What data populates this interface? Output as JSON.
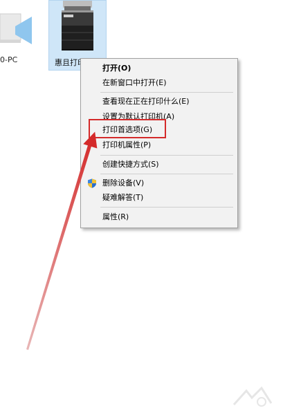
{
  "desktop": {
    "pc_label": "0-PC",
    "printer_label": "惠且打印"
  },
  "context_menu": {
    "items": [
      {
        "label": "打开(O)",
        "bold": true
      },
      {
        "label": "在新窗口中打开(E)"
      },
      {
        "label": "查看现在正在打印什么(E)"
      },
      {
        "label": "设置为默认打印机(A)"
      },
      {
        "label": "打印首选项(G)",
        "highlighted": true
      },
      {
        "label": "打印机属性(P)"
      },
      {
        "label": "创建快捷方式(S)"
      },
      {
        "label": "删除设备(V)",
        "icon": "shield-icon"
      },
      {
        "label": "疑难解答(T)"
      },
      {
        "label": "属性(R)"
      }
    ]
  },
  "colors": {
    "annotation": "#d42a2a",
    "selection": "#cfe6f8",
    "menu_bg": "#f2f2f2"
  }
}
